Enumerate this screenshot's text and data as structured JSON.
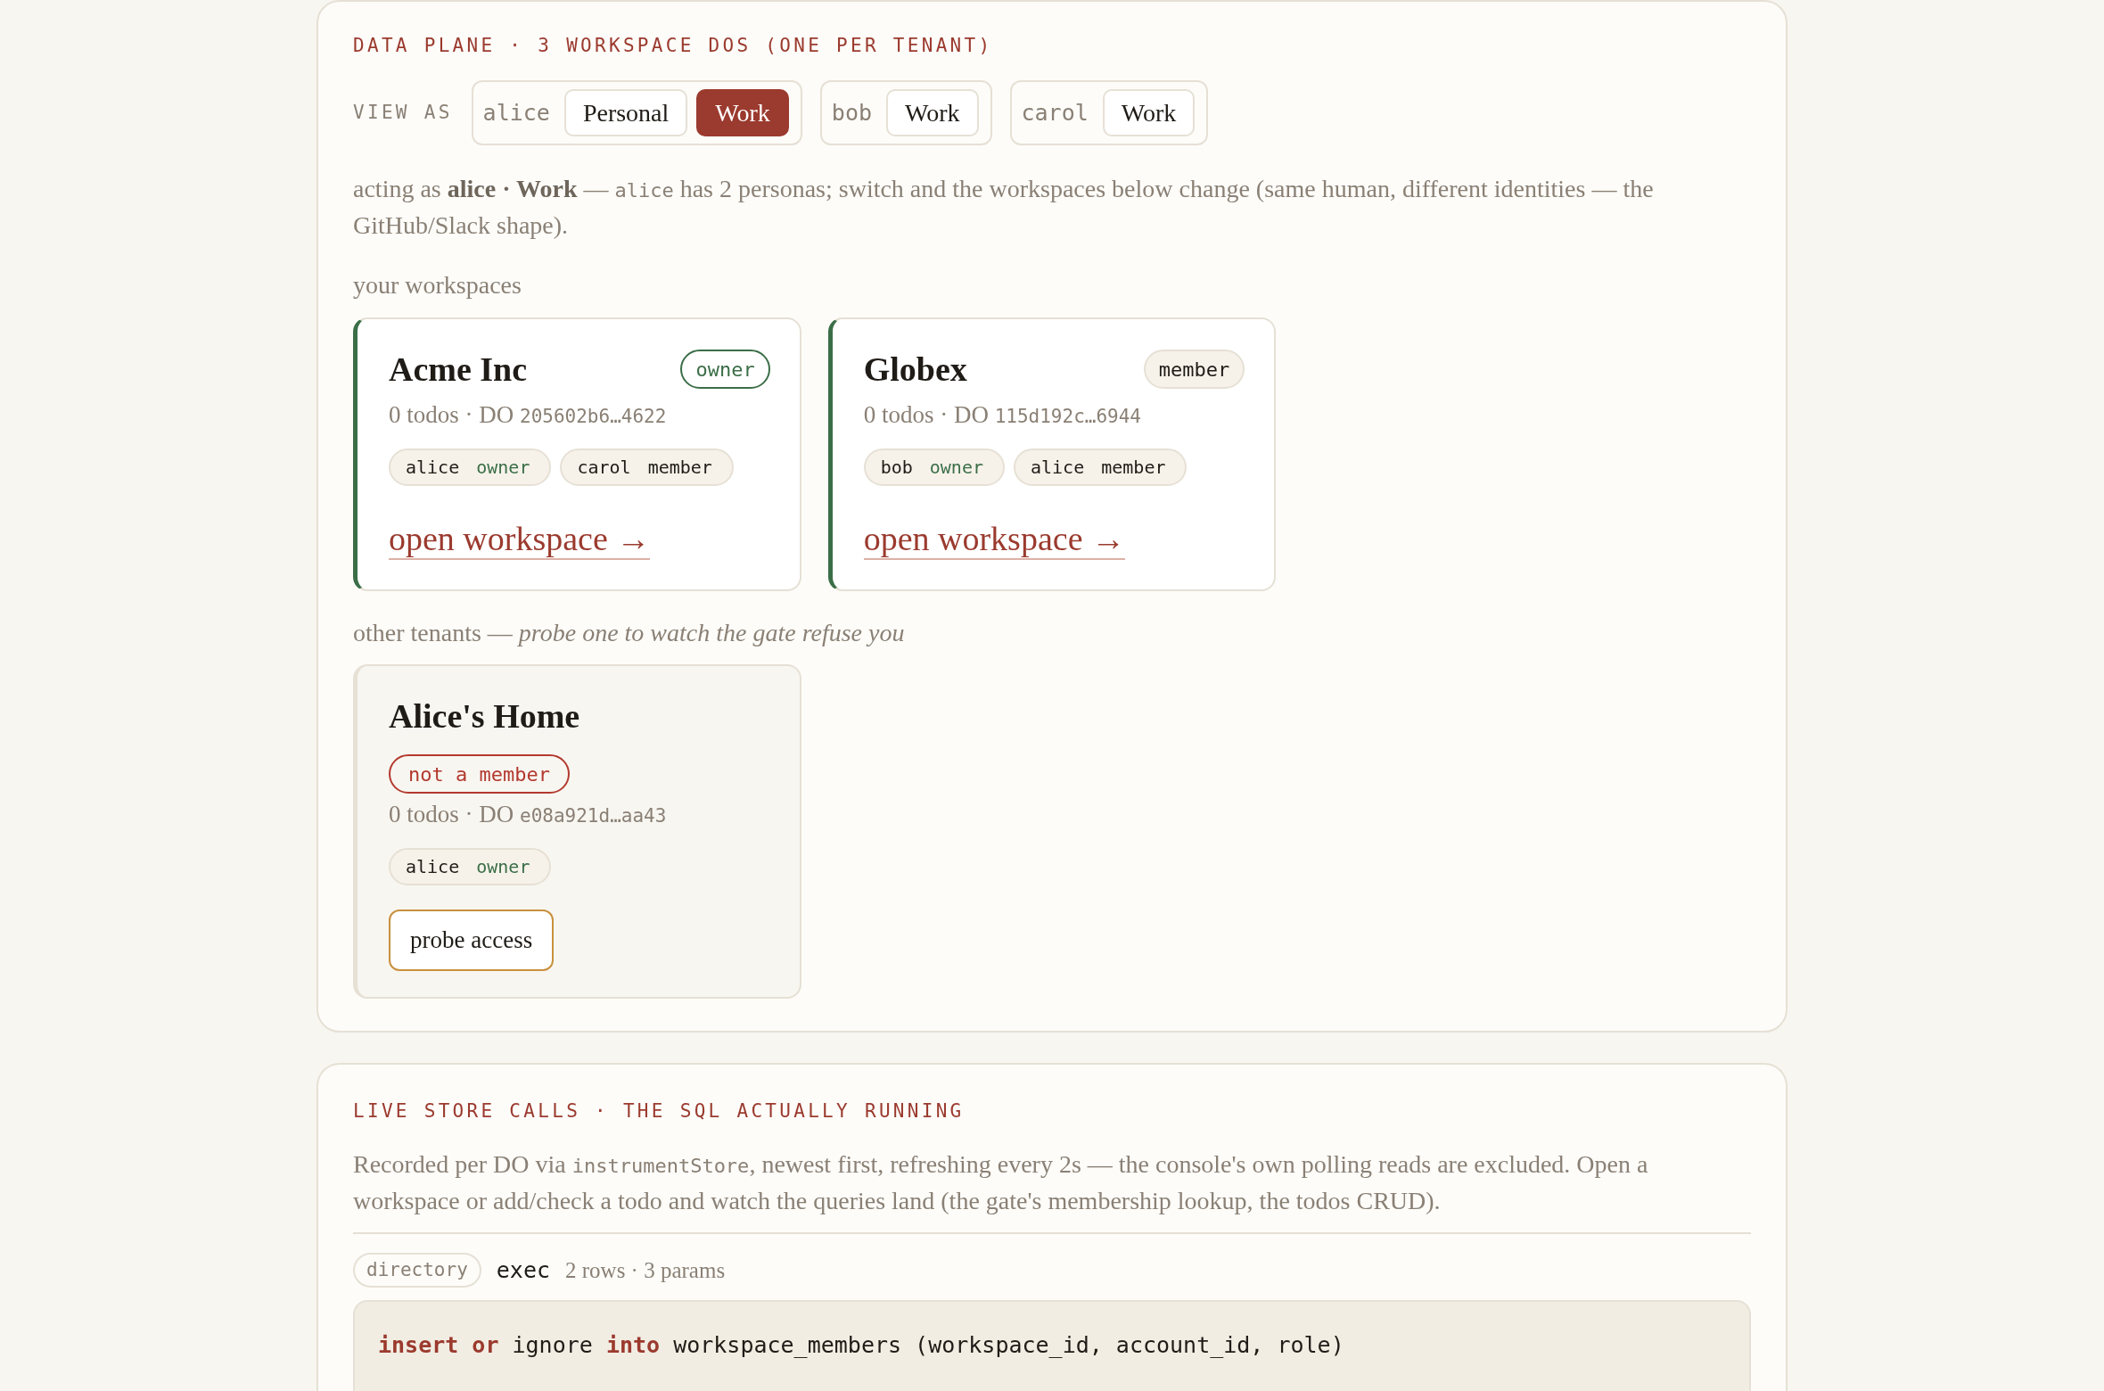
{
  "data_plane": {
    "heading": "DATA PLANE · 3 WORKSPACE DOS (ONE PER TENANT)",
    "view_as": {
      "label": "VIEW AS",
      "accounts": [
        {
          "name": "alice",
          "personas": [
            {
              "label": "Personal",
              "selected": false
            },
            {
              "label": "Work",
              "selected": true
            }
          ]
        },
        {
          "name": "bob",
          "personas": [
            {
              "label": "Work",
              "selected": false
            }
          ]
        },
        {
          "name": "carol",
          "personas": [
            {
              "label": "Work",
              "selected": false
            }
          ]
        }
      ]
    },
    "note": [
      {
        "kind": "text",
        "text": "acting as **alice · Work** — "
      },
      {
        "kind": "code",
        "text": "alice"
      },
      {
        "kind": "text",
        "text": " has 2 personas; switch and the workspaces below change (same human, different identities — the GitHub/Slack shape)."
      }
    ],
    "your_workspaces": {
      "label": "your workspaces",
      "cards": [
        {
          "name": "Acme Inc",
          "badge": {
            "label": "owner",
            "kind": "owner"
          },
          "meta": [
            {
              "kind": "text",
              "text": "0 todos · DO "
            },
            {
              "kind": "code",
              "text": "205602b6…4622"
            }
          ],
          "members": [
            {
              "name": "alice",
              "role": "owner",
              "kind": "owner"
            },
            {
              "name": "carol",
              "role": "member",
              "kind": "member"
            }
          ],
          "link": "open workspace →"
        },
        {
          "name": "Globex",
          "badge": {
            "label": "member",
            "kind": "member"
          },
          "meta": [
            {
              "kind": "text",
              "text": "0 todos · DO "
            },
            {
              "kind": "code",
              "text": "115d192c…6944"
            }
          ],
          "members": [
            {
              "name": "bob",
              "role": "owner",
              "kind": "owner"
            },
            {
              "name": "alice",
              "role": "member",
              "kind": "member"
            }
          ],
          "link": "open workspace →"
        }
      ]
    },
    "other_tenants": {
      "label": "other tenants — *probe one to watch the gate refuse you*",
      "cards": [
        {
          "name": "Alice's Home",
          "badge": {
            "label": "not a member",
            "kind": "denied"
          },
          "meta": [
            {
              "kind": "text",
              "text": "0 todos · DO "
            },
            {
              "kind": "code",
              "text": "e08a921d…aa43"
            }
          ],
          "members": [
            {
              "name": "alice",
              "role": "owner",
              "kind": "owner"
            }
          ],
          "button": "probe access"
        }
      ]
    }
  },
  "live_store": {
    "heading": "LIVE STORE CALLS · THE SQL ACTUALLY RUNNING",
    "note": [
      {
        "kind": "text",
        "text": "Recorded per DO via "
      },
      {
        "kind": "code",
        "text": "instrumentStore"
      },
      {
        "kind": "text",
        "text": ", newest first, refreshing every 2s — the console's own polling reads are excluded. Open a workspace or add/check a todo and watch the queries land (the gate's membership lookup, the todos CRUD)."
      }
    ],
    "calls": [
      {
        "store": "directory",
        "op": "exec",
        "summary": "2 rows · 3 params",
        "sql": [
          {
            "kind": "keyword",
            "text": "insert or"
          },
          {
            "kind": "plain",
            "text": " ignore "
          },
          {
            "kind": "keyword",
            "text": "into"
          },
          {
            "kind": "plain",
            "text": " workspace_members (workspace_id, account_id, role)"
          }
        ]
      }
    ]
  }
}
